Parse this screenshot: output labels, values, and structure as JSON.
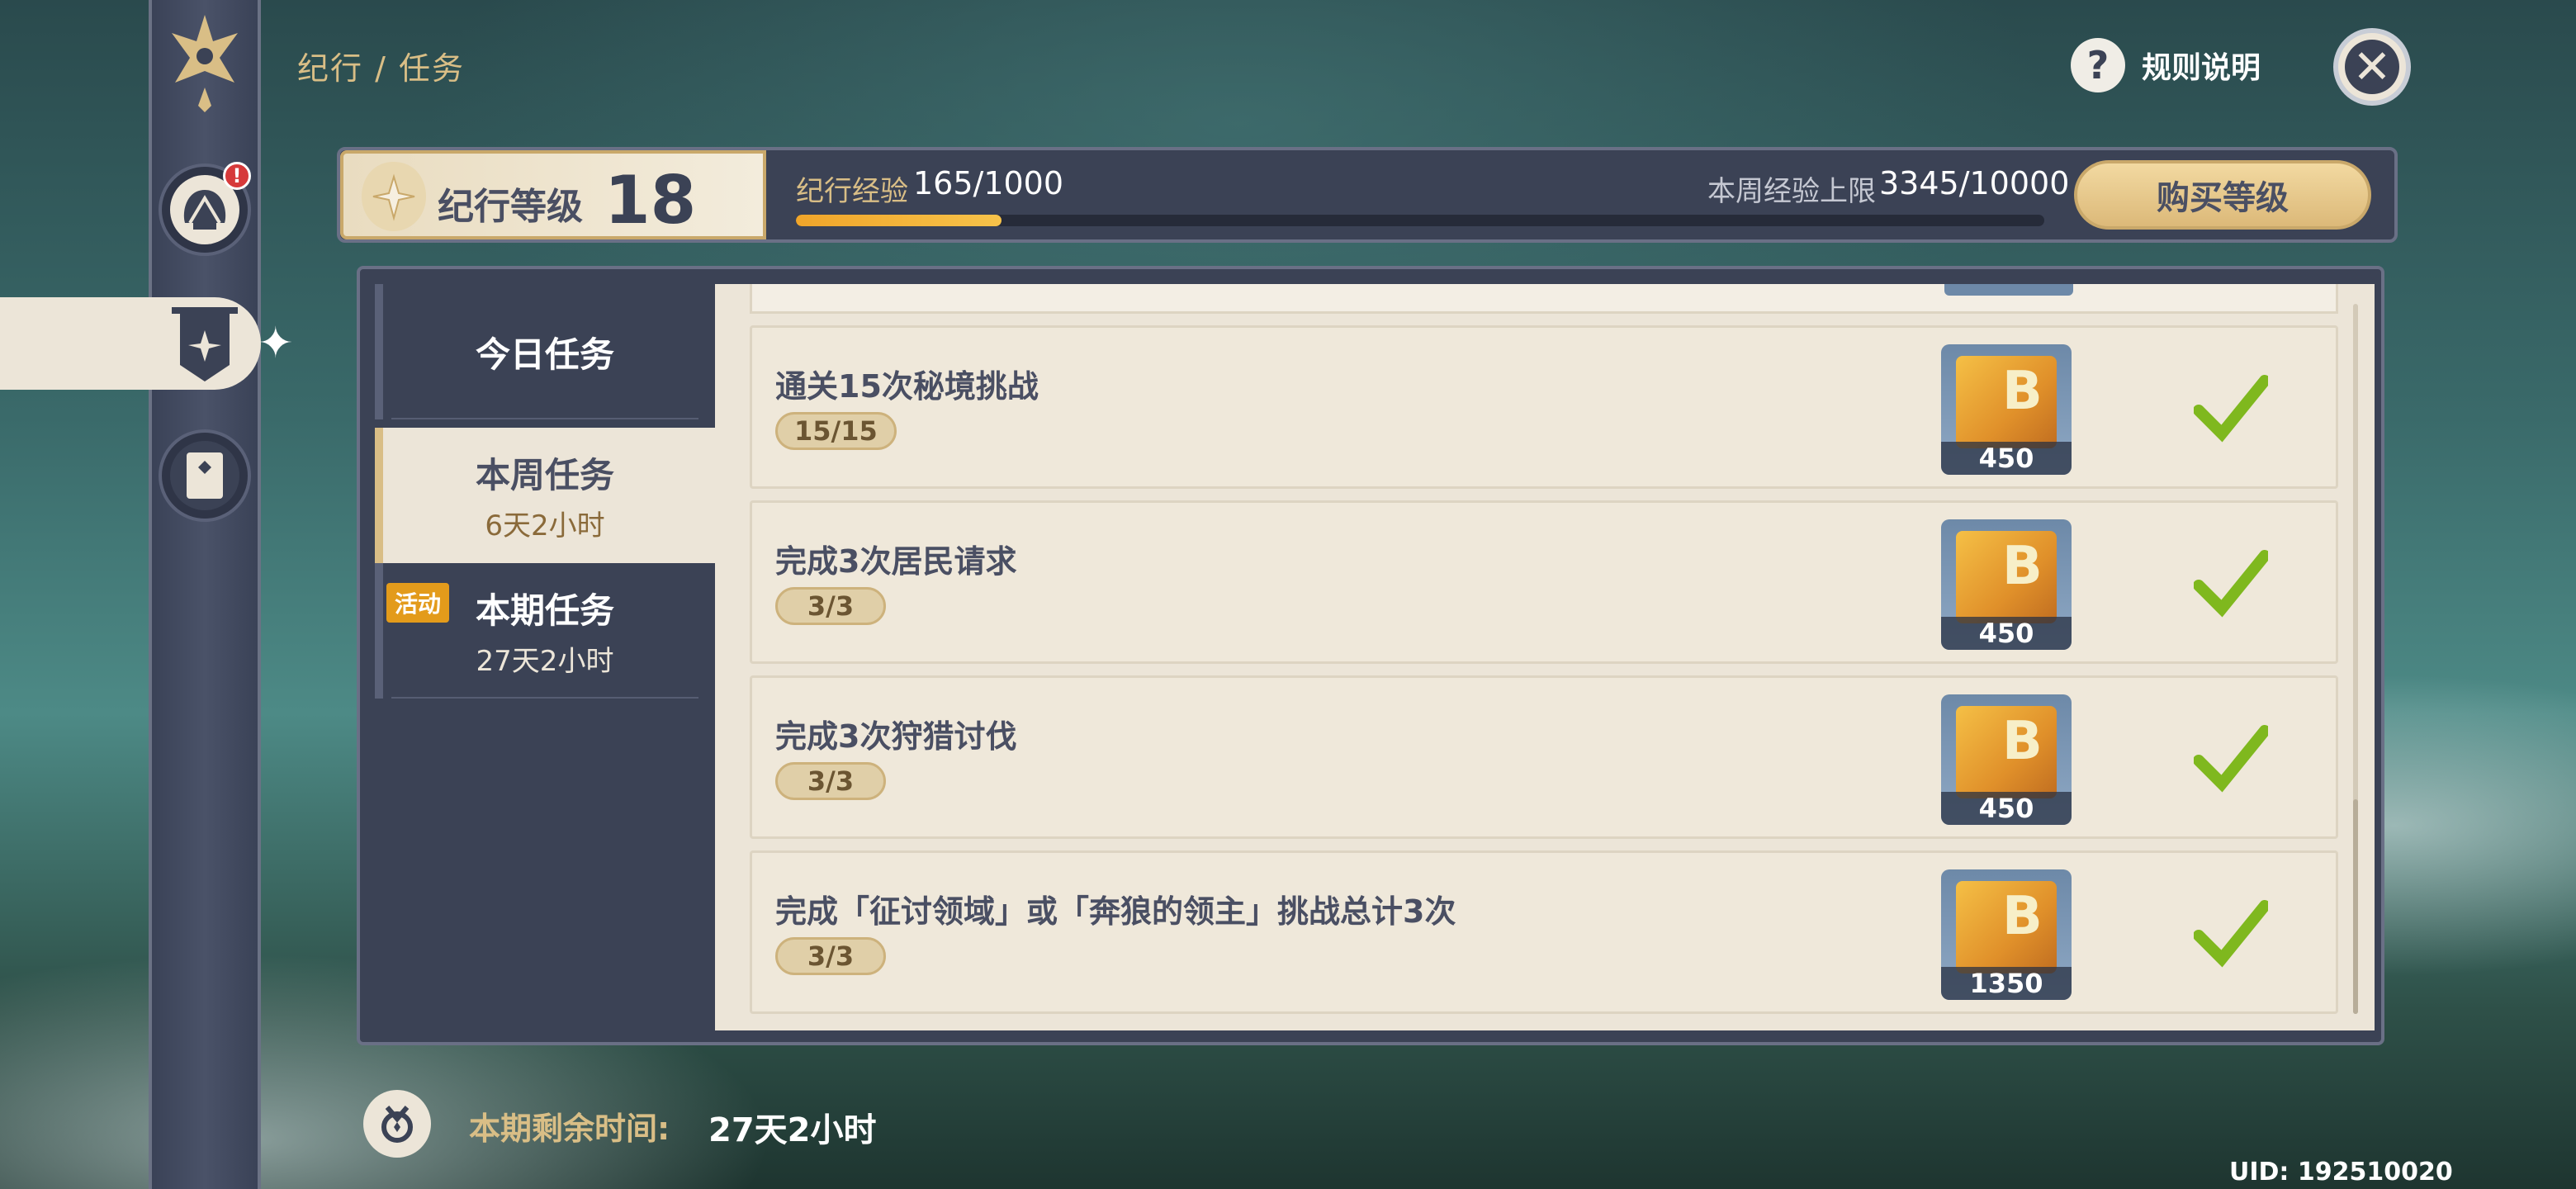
{
  "header": {
    "breadcrumb": "纪行 / 任务",
    "rules_label": "规则说明"
  },
  "level": {
    "label": "纪行等级",
    "value": "18",
    "exp_label": "纪行经验",
    "exp_value": "165/1000",
    "exp_fraction": 0.165,
    "weekly_label": "本周经验上限",
    "weekly_value": "3345/10000",
    "buy_button": "购买等级"
  },
  "tabs": [
    {
      "title": "今日任务",
      "sub": ""
    },
    {
      "title": "本周任务",
      "sub": "6天2小时"
    },
    {
      "title": "本期任务",
      "sub": "27天2小时"
    }
  ],
  "event_tag": "活动",
  "tasks": [
    {
      "title": "通关15次秘境挑战",
      "progress": "15/15",
      "reward": "450",
      "done": true
    },
    {
      "title": "完成3次居民请求",
      "progress": "3/3",
      "reward": "450",
      "done": true
    },
    {
      "title": "完成3次狩猎讨伐",
      "progress": "3/3",
      "reward": "450",
      "done": true
    },
    {
      "title": "完成「征讨领域」或「奔狼的领主」挑战总计3次",
      "progress": "3/3",
      "reward": "1350",
      "done": true
    }
  ],
  "footer": {
    "remaining_label": "本期剩余时间:",
    "remaining_value": "27天2小时",
    "uid": "UID: 192510020"
  },
  "colors": {
    "panel": "#3b4255",
    "parchment": "#ece5d8",
    "gold": "#d9be86",
    "check_green": "#7fb81e",
    "progress": "#f0a52a",
    "alert_red": "#d6393a"
  },
  "icons": [
    "paimon-menu-icon",
    "battle-pass-icon",
    "bp-shop-icon",
    "question-icon",
    "close-icon",
    "check-icon",
    "bp-exp-icon",
    "hourglass-icon"
  ]
}
